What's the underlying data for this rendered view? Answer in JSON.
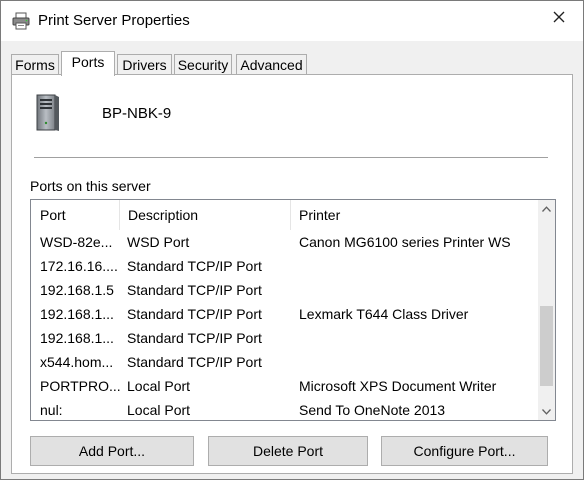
{
  "window": {
    "title": "Print Server Properties",
    "close_glyph": "✕"
  },
  "tabs": [
    {
      "label": "Forms",
      "active": false
    },
    {
      "label": "Ports",
      "active": true
    },
    {
      "label": "Drivers",
      "active": false
    },
    {
      "label": "Security",
      "active": false
    },
    {
      "label": "Advanced",
      "active": false
    }
  ],
  "server": {
    "name": "BP-NBK-9",
    "icon": "server-icon"
  },
  "ports_section": {
    "label": "Ports on this server",
    "columns": [
      "Port",
      "Description",
      "Printer"
    ],
    "rows": [
      {
        "port": "WSD-82e...",
        "description": "WSD Port",
        "printer": "Canon MG6100 series Printer WS"
      },
      {
        "port": "172.16.16....",
        "description": "Standard TCP/IP Port",
        "printer": ""
      },
      {
        "port": "192.168.1.5",
        "description": "Standard TCP/IP Port",
        "printer": ""
      },
      {
        "port": "192.168.1...",
        "description": "Standard TCP/IP Port",
        "printer": "Lexmark T644 Class Driver"
      },
      {
        "port": "192.168.1...",
        "description": "Standard TCP/IP Port",
        "printer": ""
      },
      {
        "port": "x544.hom...",
        "description": "Standard TCP/IP Port",
        "printer": ""
      },
      {
        "port": "PORTPRO...",
        "description": "Local Port",
        "printer": "Microsoft XPS Document Writer"
      },
      {
        "port": "nul:",
        "description": "Local Port",
        "printer": "Send To OneNote 2013"
      }
    ]
  },
  "buttons": {
    "add_port": "Add Port...",
    "delete_port": "Delete Port",
    "configure_port": "Configure Port..."
  },
  "colors": {
    "client_bg": "#f0f0f0",
    "button_bg": "#e1e1e1",
    "border": "#adadad"
  }
}
